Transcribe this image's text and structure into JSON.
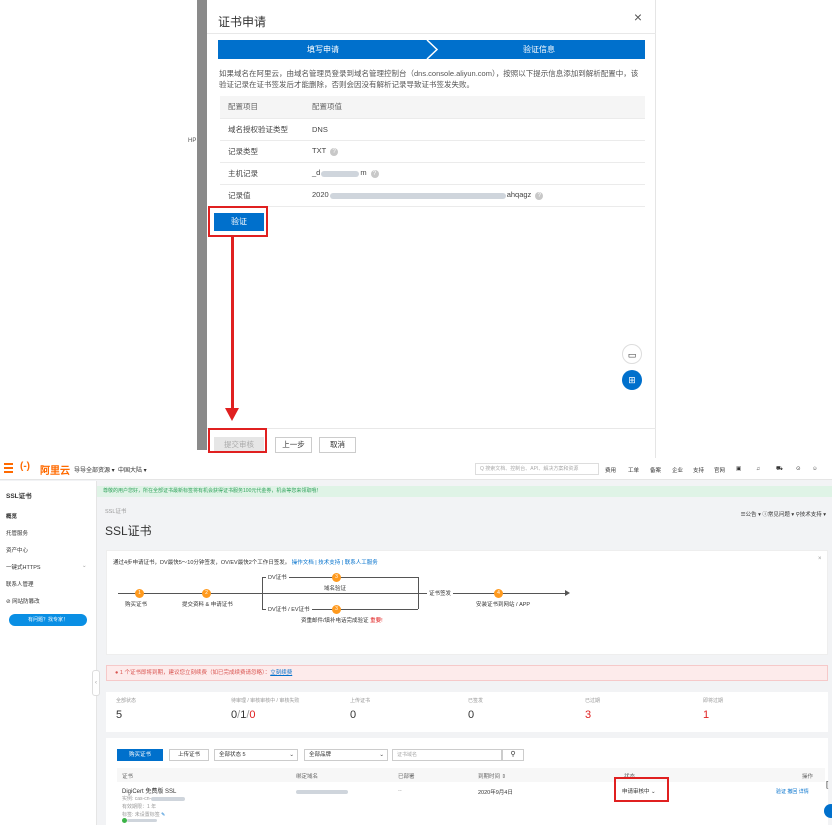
{
  "dialog": {
    "title": "证书申请",
    "close": "×",
    "steps": [
      "填写申请",
      "验证信息"
    ],
    "description": "如果域名在阿里云，由域名管理员登录到域名管理控制台（dns.console.aliyun.com），按照以下提示信息添加到解析配置中，该验证记录在证书签发后才能删除，否则会因没有解析记录导致证书签发失败。",
    "table": {
      "header": [
        "配置项目",
        "配置项值"
      ],
      "rows": [
        {
          "key": "域名授权验证类型",
          "value": "DNS"
        },
        {
          "key": "记录类型",
          "value": "TXT"
        },
        {
          "key": "主机记录",
          "value": "_d",
          "value_tail": "m"
        },
        {
          "key": "记录值",
          "value": "2020",
          "value_tail": "ahqagz"
        }
      ]
    },
    "verify_button": "验证",
    "submit_button": "提交审核",
    "prev_button": "上一步",
    "cancel_button": "取消"
  },
  "console": {
    "logo": "阿里云",
    "topbar": {
      "resources": "导导全部资源 ▾",
      "region": "中国大陆 ▾",
      "search_placeholder": "Q 搜索文档、控制台、API、解决方案和资源",
      "links": [
        "费用",
        "工单",
        "备案",
        "企业",
        "支持",
        "官网"
      ]
    },
    "sidebar": {
      "items": [
        "SSL证书",
        "概览",
        "托管服务",
        "资产中心",
        "一键式HTTPS",
        "联系人管理",
        "⊘ 网站防篡改"
      ],
      "help_button": "有问题？找专家！"
    },
    "notice": "尊敬的用户您好，所在全部证书最新标签将有机会获得证书服务100元代金券，机会等您来领取哦！",
    "breadcrumb": "SSL证书",
    "head_links": "☰公告 ▾   ⓘ常见问题 ▾   ⚲技术支持 ▾",
    "page_title": "SSL证书",
    "flow": {
      "intro": "通过4步申请证书，DV最快5～10分钟签发，OV/EV最快2个工作日签发。",
      "intro_links": "操作文档 | 技术支持 | 联系人工服务",
      "nodes": [
        "购买证书",
        "提交资料 & 申请证书",
        "域名验证",
        "资重邮件/填补电话完成验证",
        "安装证书到网站 / APP"
      ],
      "branch_dv": "DV证书",
      "branch_ov": "DV证书 / EV证书",
      "signed": "证书签发",
      "important": "重要!"
    },
    "alert": "1 个证书即将到期，建议您立刻续费（如已完成续费请忽略）：",
    "alert_link": "立刻续费",
    "stats": [
      {
        "label": "全部状态",
        "value": "5"
      },
      {
        "label": "待审理 / 审核审核中 / 审核失败",
        "value_parts": [
          "0",
          "/",
          "1",
          "/",
          "0"
        ]
      },
      {
        "label": "上传证书",
        "value": "0"
      },
      {
        "label": "已签发",
        "value": "0"
      },
      {
        "label": "已过期",
        "value": "3"
      },
      {
        "label": "即将过期",
        "value": "1"
      }
    ],
    "toolbar": {
      "buy": "购买证书",
      "upload": "上传证书",
      "filter_status": "全部状态 5",
      "filter_brand": "全部品牌",
      "search_placeholder": "证书域名"
    },
    "table": {
      "headers": [
        "证书",
        "绑定域名",
        "已部署",
        "到期时间 ⇕",
        "状态",
        "操作"
      ],
      "row": {
        "name": "DigiCert 免费版 SSL",
        "instance": "实例: cas-cn-",
        "validity": "有效期限：1 年",
        "tag": "标签: 未设置标签",
        "deployed": "--",
        "expiry": "2020年9月4日",
        "status": "申请审核中 ⌄",
        "actions": "验证  撤回  详情"
      }
    }
  },
  "colors": {
    "primary": "#0070cc",
    "accent": "#ff6a00",
    "highlight": "#e02020"
  }
}
